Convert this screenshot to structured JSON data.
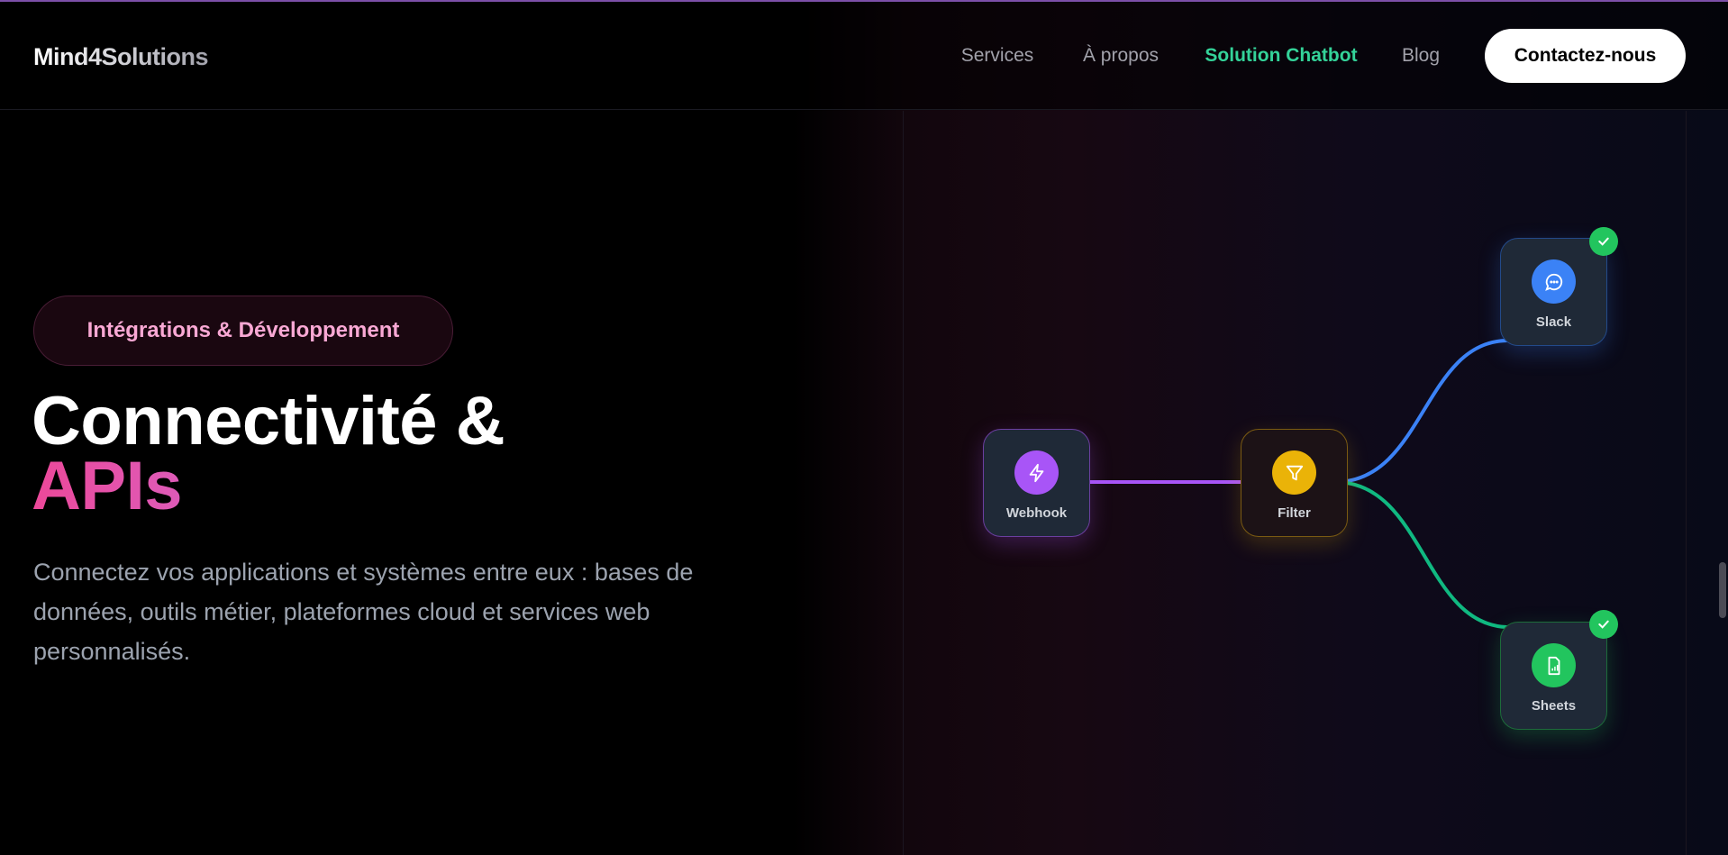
{
  "nav": {
    "logo": "Mind4Solutions",
    "links": [
      {
        "label": "Services"
      },
      {
        "label": "À propos"
      },
      {
        "label": "Solution Chatbot",
        "active": true
      },
      {
        "label": "Blog"
      }
    ],
    "cta": "Contactez-nous"
  },
  "hero": {
    "badge": "Intégrations & Développement",
    "title_line1": "Connectivité &",
    "title_line2": "APIs",
    "description": "Connectez vos applications et systèmes entre eux : bases de données, outils métier, plateformes cloud et services web personnalisés."
  },
  "workflow": {
    "nodes": [
      {
        "label": "Webhook",
        "icon": "lightning-icon",
        "color": "#a855f7"
      },
      {
        "label": "Filter",
        "icon": "filter-icon",
        "color": "#eab308"
      },
      {
        "label": "Slack",
        "icon": "chat-icon",
        "color": "#3b82f6",
        "status": "success"
      },
      {
        "label": "Sheets",
        "icon": "spreadsheet-icon",
        "color": "#22c55e",
        "status": "success"
      }
    ]
  }
}
